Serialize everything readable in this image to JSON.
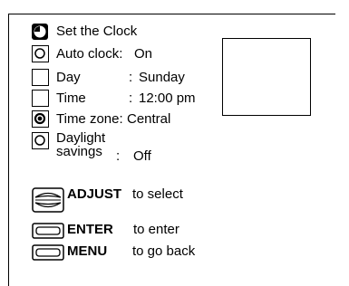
{
  "menu": {
    "title": "Set the Clock",
    "items": [
      {
        "label": "Auto clock:",
        "value": "On",
        "state": "dot"
      },
      {
        "label": "Day",
        "sep": ":",
        "value": "Sunday",
        "state": "empty"
      },
      {
        "label": "Time",
        "sep": ":",
        "value": "12:00 pm",
        "state": "empty"
      },
      {
        "label": "Time zone:",
        "value": "Central",
        "state": "dot-bold"
      },
      {
        "label": "Daylight",
        "label2": "savings",
        "sep": ":",
        "value": "Off",
        "state": "dot"
      }
    ]
  },
  "controls": {
    "adjust_key": "ADJUST",
    "adjust_text": "to select",
    "enter_key": "ENTER",
    "enter_text": "to enter",
    "menu_key": "MENU",
    "menu_text": "to go back"
  }
}
